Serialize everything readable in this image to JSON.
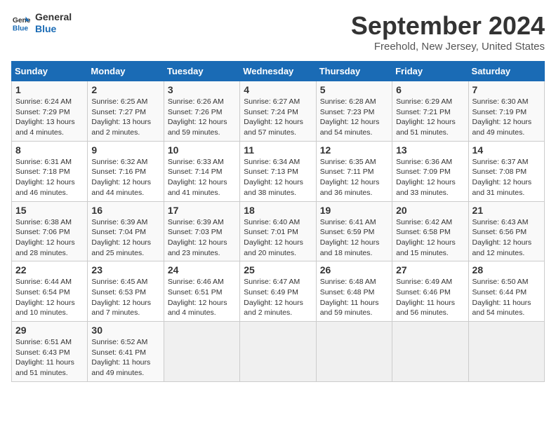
{
  "logo": {
    "line1": "General",
    "line2": "Blue"
  },
  "title": "September 2024",
  "subtitle": "Freehold, New Jersey, United States",
  "days_of_week": [
    "Sunday",
    "Monday",
    "Tuesday",
    "Wednesday",
    "Thursday",
    "Friday",
    "Saturday"
  ],
  "weeks": [
    [
      {
        "day": "1",
        "info": "Sunrise: 6:24 AM\nSunset: 7:29 PM\nDaylight: 13 hours\nand 4 minutes."
      },
      {
        "day": "2",
        "info": "Sunrise: 6:25 AM\nSunset: 7:27 PM\nDaylight: 13 hours\nand 2 minutes."
      },
      {
        "day": "3",
        "info": "Sunrise: 6:26 AM\nSunset: 7:26 PM\nDaylight: 12 hours\nand 59 minutes."
      },
      {
        "day": "4",
        "info": "Sunrise: 6:27 AM\nSunset: 7:24 PM\nDaylight: 12 hours\nand 57 minutes."
      },
      {
        "day": "5",
        "info": "Sunrise: 6:28 AM\nSunset: 7:23 PM\nDaylight: 12 hours\nand 54 minutes."
      },
      {
        "day": "6",
        "info": "Sunrise: 6:29 AM\nSunset: 7:21 PM\nDaylight: 12 hours\nand 51 minutes."
      },
      {
        "day": "7",
        "info": "Sunrise: 6:30 AM\nSunset: 7:19 PM\nDaylight: 12 hours\nand 49 minutes."
      }
    ],
    [
      {
        "day": "8",
        "info": "Sunrise: 6:31 AM\nSunset: 7:18 PM\nDaylight: 12 hours\nand 46 minutes."
      },
      {
        "day": "9",
        "info": "Sunrise: 6:32 AM\nSunset: 7:16 PM\nDaylight: 12 hours\nand 44 minutes."
      },
      {
        "day": "10",
        "info": "Sunrise: 6:33 AM\nSunset: 7:14 PM\nDaylight: 12 hours\nand 41 minutes."
      },
      {
        "day": "11",
        "info": "Sunrise: 6:34 AM\nSunset: 7:13 PM\nDaylight: 12 hours\nand 38 minutes."
      },
      {
        "day": "12",
        "info": "Sunrise: 6:35 AM\nSunset: 7:11 PM\nDaylight: 12 hours\nand 36 minutes."
      },
      {
        "day": "13",
        "info": "Sunrise: 6:36 AM\nSunset: 7:09 PM\nDaylight: 12 hours\nand 33 minutes."
      },
      {
        "day": "14",
        "info": "Sunrise: 6:37 AM\nSunset: 7:08 PM\nDaylight: 12 hours\nand 31 minutes."
      }
    ],
    [
      {
        "day": "15",
        "info": "Sunrise: 6:38 AM\nSunset: 7:06 PM\nDaylight: 12 hours\nand 28 minutes."
      },
      {
        "day": "16",
        "info": "Sunrise: 6:39 AM\nSunset: 7:04 PM\nDaylight: 12 hours\nand 25 minutes."
      },
      {
        "day": "17",
        "info": "Sunrise: 6:39 AM\nSunset: 7:03 PM\nDaylight: 12 hours\nand 23 minutes."
      },
      {
        "day": "18",
        "info": "Sunrise: 6:40 AM\nSunset: 7:01 PM\nDaylight: 12 hours\nand 20 minutes."
      },
      {
        "day": "19",
        "info": "Sunrise: 6:41 AM\nSunset: 6:59 PM\nDaylight: 12 hours\nand 18 minutes."
      },
      {
        "day": "20",
        "info": "Sunrise: 6:42 AM\nSunset: 6:58 PM\nDaylight: 12 hours\nand 15 minutes."
      },
      {
        "day": "21",
        "info": "Sunrise: 6:43 AM\nSunset: 6:56 PM\nDaylight: 12 hours\nand 12 minutes."
      }
    ],
    [
      {
        "day": "22",
        "info": "Sunrise: 6:44 AM\nSunset: 6:54 PM\nDaylight: 12 hours\nand 10 minutes."
      },
      {
        "day": "23",
        "info": "Sunrise: 6:45 AM\nSunset: 6:53 PM\nDaylight: 12 hours\nand 7 minutes."
      },
      {
        "day": "24",
        "info": "Sunrise: 6:46 AM\nSunset: 6:51 PM\nDaylight: 12 hours\nand 4 minutes."
      },
      {
        "day": "25",
        "info": "Sunrise: 6:47 AM\nSunset: 6:49 PM\nDaylight: 12 hours\nand 2 minutes."
      },
      {
        "day": "26",
        "info": "Sunrise: 6:48 AM\nSunset: 6:48 PM\nDaylight: 11 hours\nand 59 minutes."
      },
      {
        "day": "27",
        "info": "Sunrise: 6:49 AM\nSunset: 6:46 PM\nDaylight: 11 hours\nand 56 minutes."
      },
      {
        "day": "28",
        "info": "Sunrise: 6:50 AM\nSunset: 6:44 PM\nDaylight: 11 hours\nand 54 minutes."
      }
    ],
    [
      {
        "day": "29",
        "info": "Sunrise: 6:51 AM\nSunset: 6:43 PM\nDaylight: 11 hours\nand 51 minutes."
      },
      {
        "day": "30",
        "info": "Sunrise: 6:52 AM\nSunset: 6:41 PM\nDaylight: 11 hours\nand 49 minutes."
      },
      {
        "day": "",
        "info": ""
      },
      {
        "day": "",
        "info": ""
      },
      {
        "day": "",
        "info": ""
      },
      {
        "day": "",
        "info": ""
      },
      {
        "day": "",
        "info": ""
      }
    ]
  ]
}
